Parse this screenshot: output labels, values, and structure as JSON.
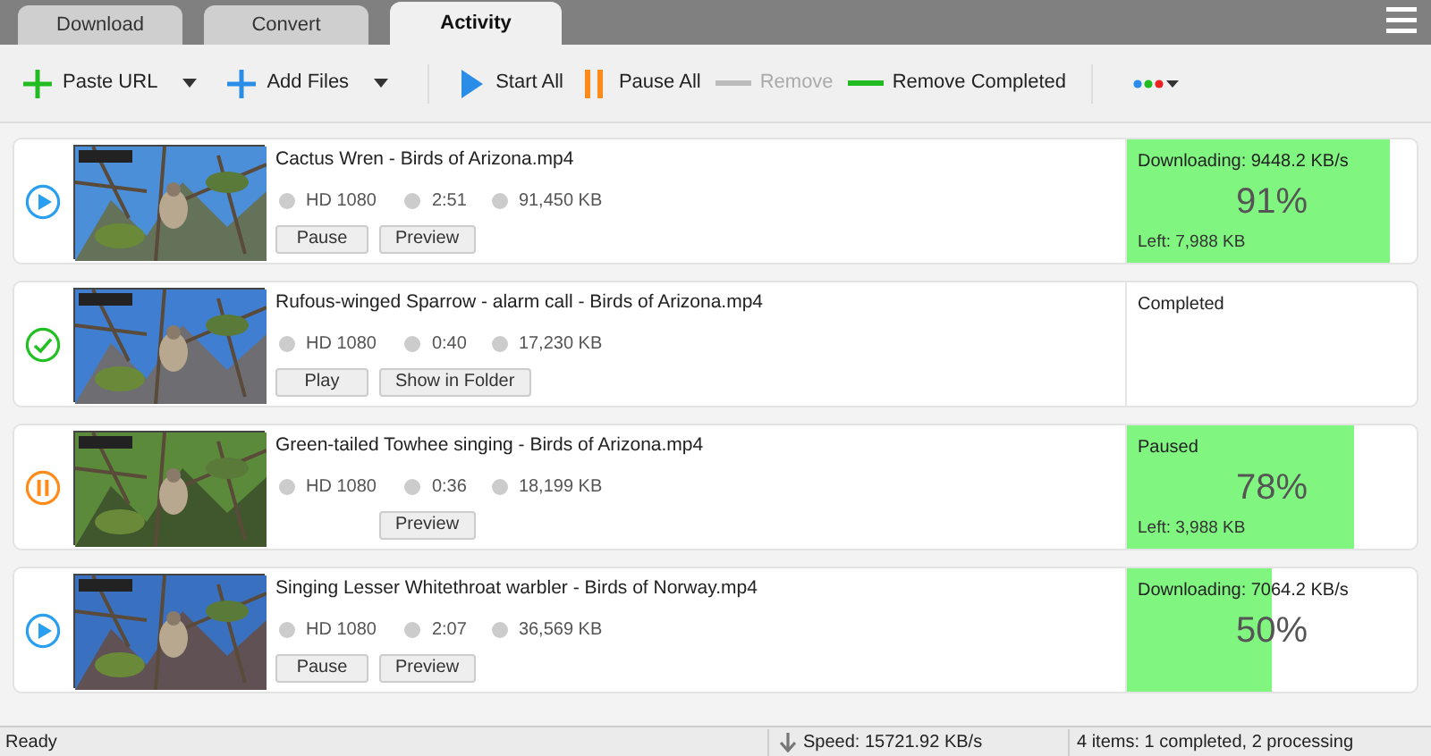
{
  "tabs": [
    {
      "label": "Download",
      "selected": false
    },
    {
      "label": "Convert",
      "selected": false
    },
    {
      "label": "Activity",
      "selected": true
    }
  ],
  "toolbar": [
    {
      "kind": "add",
      "label": "Paste URL",
      "color": "#22bb22",
      "dropdown": true,
      "disabled": false
    },
    {
      "kind": "add",
      "label": "Add Files",
      "color": "#2a8ee8",
      "dropdown": true,
      "disabled": false
    },
    {
      "kind": "play",
      "label": "Start All",
      "color": "#2a8ee8",
      "dropdown": false,
      "disabled": false
    },
    {
      "kind": "pause",
      "label": "Pause All",
      "color": "#ff8c1a",
      "dropdown": false,
      "disabled": false
    },
    {
      "kind": "remove",
      "label": "Remove",
      "color": "#bbbbbb",
      "dropdown": false,
      "disabled": true
    },
    {
      "kind": "remove",
      "label": "Remove Completed",
      "color": "#22bb22",
      "dropdown": false,
      "disabled": false
    }
  ],
  "items": [
    {
      "kind": "downloading",
      "title": "Cactus Wren - Birds of Arizona.mp4",
      "quality": "HD 1080",
      "duration": "2:51",
      "size": "91,450 KB",
      "buttons": [
        {
          "label": "Pause"
        },
        {
          "label": "Preview"
        }
      ],
      "status": "Downloading: 9448.2 KB/s",
      "percent": "91%",
      "level": 0.91,
      "left": "Left: 7,988 KB"
    },
    {
      "kind": "completed",
      "title": "Rufous-winged Sparrow - alarm call - Birds of Arizona.mp4",
      "quality": "HD 1080",
      "duration": "0:40",
      "size": "17,230 KB",
      "buttons": [
        {
          "label": "Play"
        },
        {
          "label": "Show in Folder"
        }
      ],
      "status": "Completed"
    },
    {
      "kind": "paused",
      "title": "Green-tailed Towhee singing - Birds of Arizona.mp4",
      "quality": "HD 1080",
      "duration": "0:36",
      "size": "18,199 KB",
      "buttons": [
        {
          "label": "Preview"
        }
      ],
      "status": "Paused",
      "percent": "78%",
      "level": 0.785,
      "left": "Left: 3,988 KB"
    },
    {
      "kind": "downloading",
      "title": "Singing Lesser Whitethroat warbler - Birds of Norway.mp4",
      "quality": "HD 1080",
      "duration": "2:07",
      "size": "36,569 KB",
      "buttons": [
        {
          "label": "Pause"
        },
        {
          "label": "Preview"
        }
      ],
      "status": "Downloading: 7064.2 KB/s",
      "percent": "50%",
      "level": 0.5
    }
  ],
  "status_bar": {
    "left": "Ready",
    "speed": "Speed: 15721.92 KB/s",
    "summary": "4 items: 1 completed, 2 processing"
  }
}
